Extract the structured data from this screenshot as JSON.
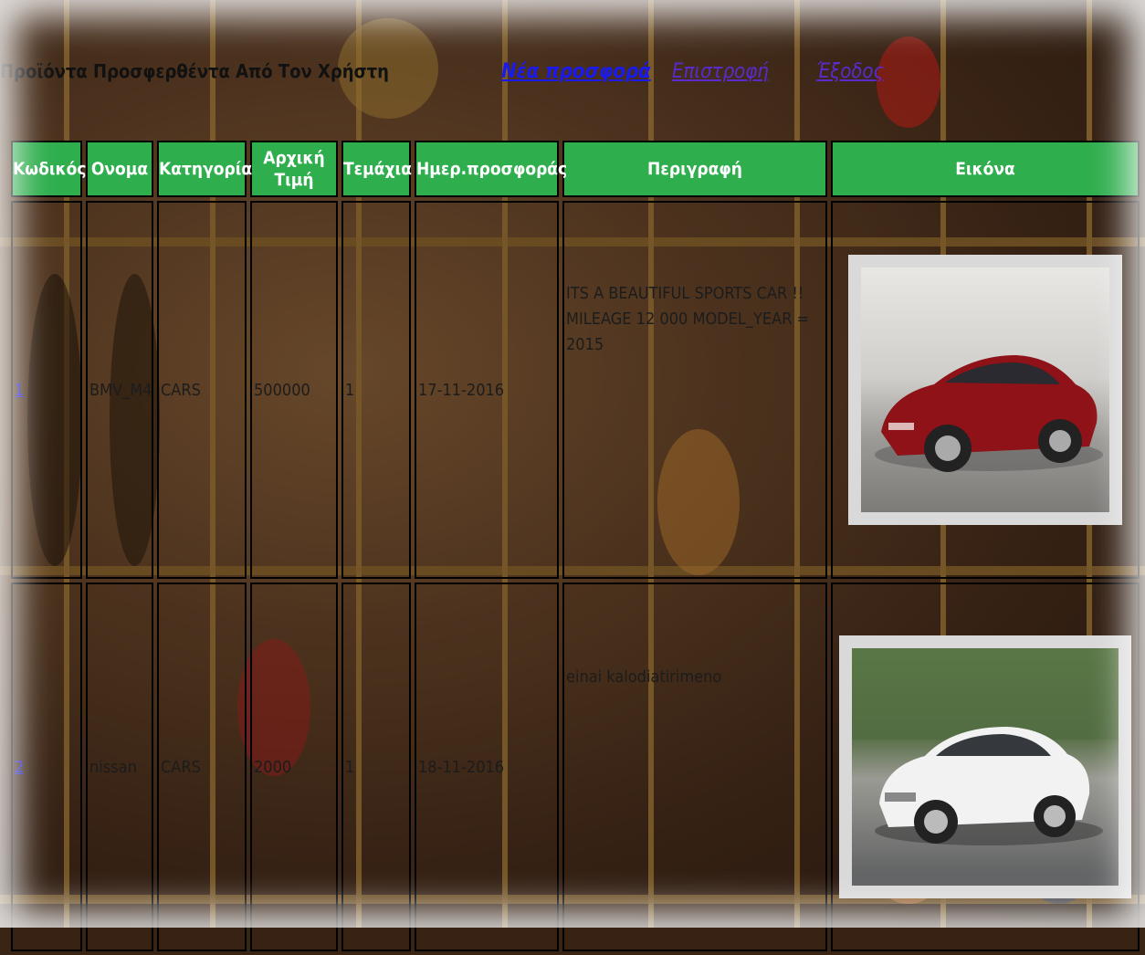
{
  "header": {
    "title": "Προϊόντα Προσφερθέντα Από Τον Χρήστη",
    "nav": {
      "new_offer": "Νέα προσφορά",
      "back": "Επιστροφή",
      "exit": "Έξοδος"
    }
  },
  "table": {
    "columns": [
      "Κωδικός",
      "Ονομα",
      "Κατηγορία",
      "Αρχική Τιμή",
      "Τεμάχια",
      "Ημερ.προσφοράς",
      "Περιγραφή",
      "Εικόνα"
    ],
    "rows": [
      {
        "code": "1",
        "name": "BMV_M4",
        "category": "CARS",
        "price": "500000",
        "pieces": "1",
        "date": "17-11-2016",
        "description": "ITS A BEAUTIFUL SPORTS CAR !! MILEAGE 12 000 MODEL_YEAR = 2015",
        "image_icon": "red-sports-car-photo"
      },
      {
        "code": "2",
        "name": "nissan",
        "category": "CARS",
        "price": "2000",
        "pieces": "1",
        "date": "18-11-2016",
        "description": "einai kalodiatirimeno",
        "image_icon": "white-sedan-photo"
      }
    ]
  },
  "colors": {
    "header_green": "#2fae4e",
    "link_blue": "#1a1aee",
    "visited_purple": "#5a2acc"
  }
}
